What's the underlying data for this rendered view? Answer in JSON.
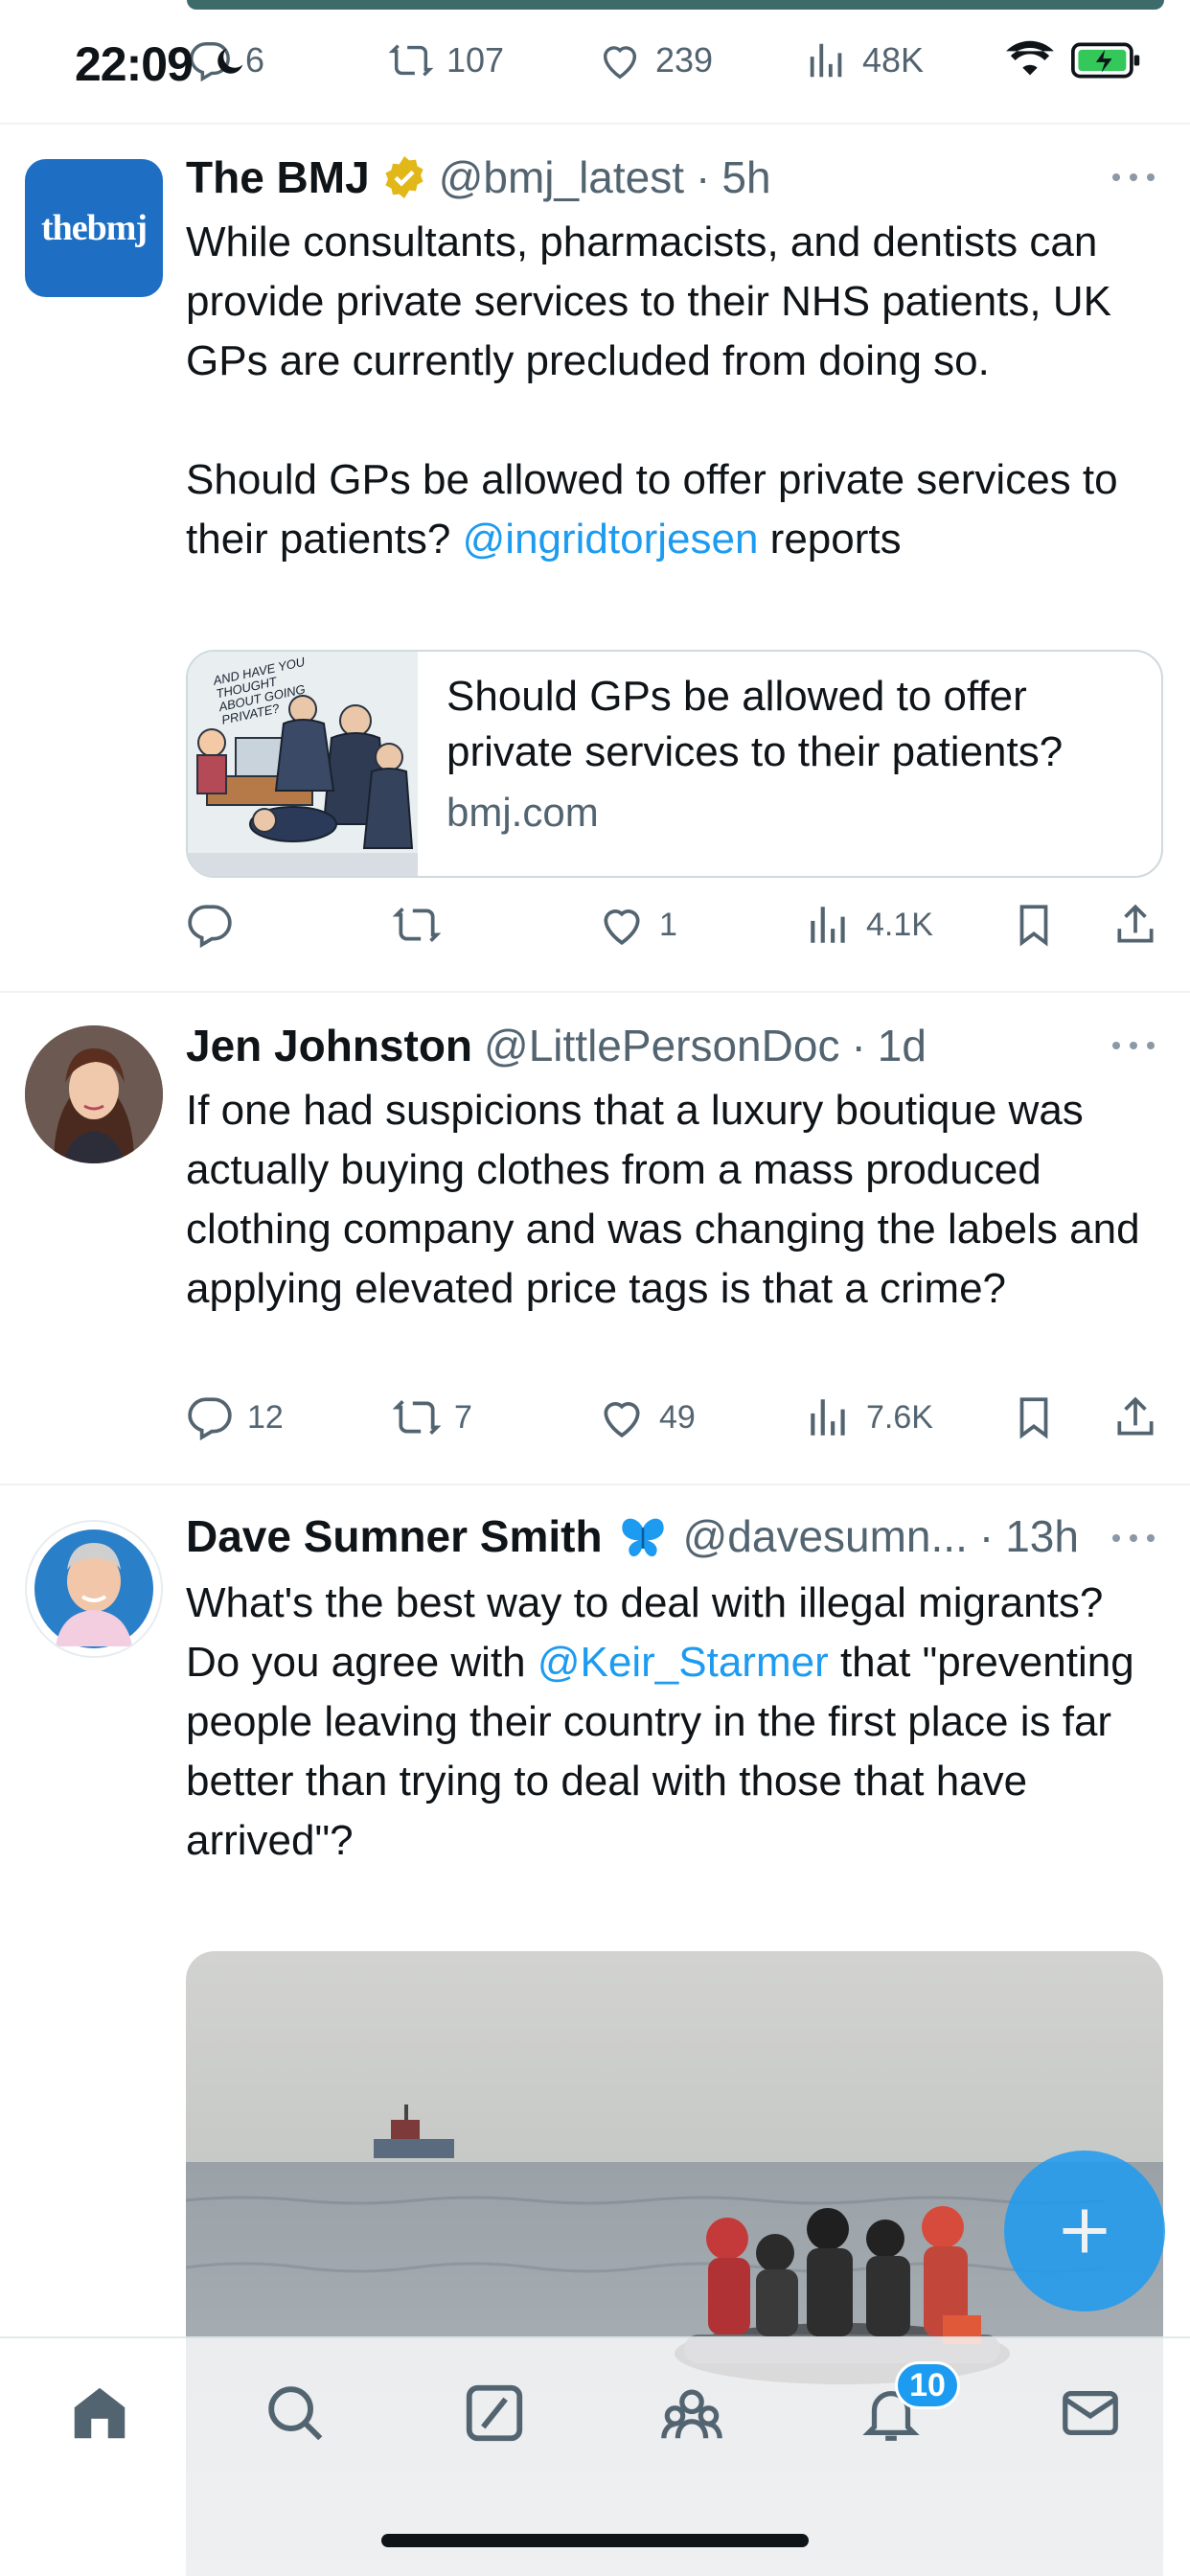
{
  "status_bar": {
    "time": "22:09"
  },
  "previous_tweet_actions": {
    "replies": "6",
    "retweets": "107",
    "likes": "239",
    "views": "48K"
  },
  "tweets": [
    {
      "name": "The BMJ",
      "handle": "@bmj_latest",
      "time": "5h",
      "avatar_text": "thebmj",
      "text_1": "While consultants, pharmacists, and dentists can provide private services to their NHS patients, UK GPs are currently precluded from doing so.\n\nShould GPs be allowed to offer private services to their patients? ",
      "mention": "@ingridtorjesen",
      "text_2": " reports",
      "card": {
        "title": "Should GPs be allowed to offer private services to their patients?",
        "domain": "bmj.com",
        "image_caption": "AND HAVE YOU THOUGHT ABOUT GOING PRIVATE?"
      },
      "actions": {
        "replies": "",
        "retweets": "",
        "likes": "1",
        "views": "4.1K"
      }
    },
    {
      "name": "Jen Johnston",
      "handle": "@LittlePersonDoc",
      "time": "1d",
      "text": "If one had suspicions that a luxury boutique was actually buying clothes from a mass produced clothing company and was changing the labels and applying elevated price tags is that a crime?",
      "actions": {
        "replies": "12",
        "retweets": "7",
        "likes": "49",
        "views": "7.6K"
      }
    },
    {
      "name": "Dave Sumner Smith",
      "handle": "@davesumn...",
      "time": "13h",
      "text_1": "What's the best way to deal with illegal migrants?\nDo you agree with ",
      "mention": "@Keir_Starmer",
      "text_2": " that \"preventing people leaving their country in the first place is far better than trying to deal with those that have arrived\"?"
    }
  ],
  "bottom_nav": {
    "notifications_badge": "10"
  },
  "colors": {
    "accent": "#1d9bf0",
    "text": "#0f1419",
    "secondary": "#536471",
    "verified_gold": "#e2b719",
    "bmj_blue": "#1e6fc4"
  }
}
